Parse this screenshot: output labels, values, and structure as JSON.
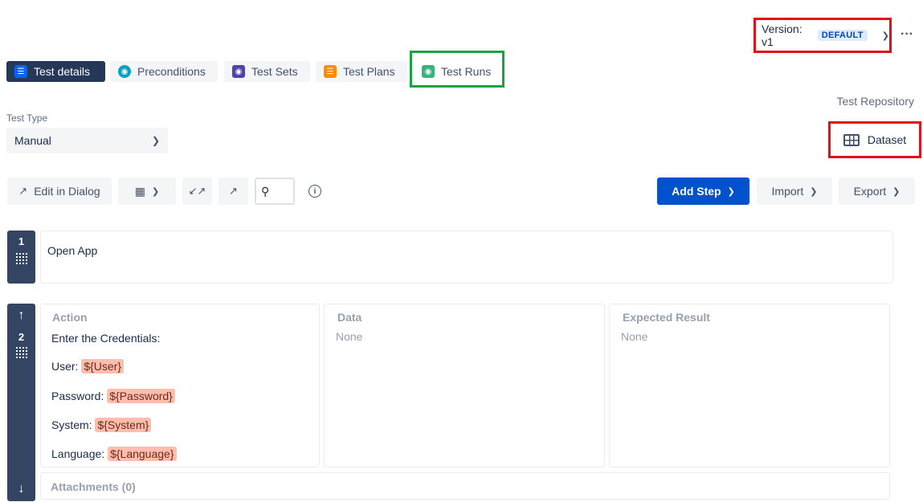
{
  "version": {
    "label": "Version: v1",
    "badge": "DEFAULT"
  },
  "more": "···",
  "tabs": [
    {
      "label": "Test details",
      "active": true,
      "icon": "list-icon",
      "color": "#0065ff"
    },
    {
      "label": "Preconditions",
      "active": false,
      "icon": "precondition-icon",
      "color": "#00a3bf"
    },
    {
      "label": "Test Sets",
      "active": false,
      "icon": "testset-icon",
      "color": "#5243aa"
    },
    {
      "label": "Test Plans",
      "active": false,
      "icon": "testplan-icon",
      "color": "#ff8b00"
    },
    {
      "label": "Test Runs",
      "active": false,
      "icon": "testrun-icon",
      "color": "#36b37e"
    }
  ],
  "test_type": {
    "label": "Test Type",
    "value": "Manual"
  },
  "repository_link": "Test Repository",
  "dataset_label": "Dataset",
  "toolbar": {
    "edit_dialog": "Edit in Dialog",
    "add_step": "Add Step",
    "import": "Import",
    "export": "Export"
  },
  "steps": [
    {
      "number": "1",
      "action": "Open App"
    },
    {
      "number": "2",
      "headers": {
        "action": "Action",
        "data": "Data",
        "expected": "Expected Result"
      },
      "action_title": "Enter the Credentials:",
      "fields": [
        {
          "label": "User:",
          "param": "${User}"
        },
        {
          "label": "Password:",
          "param": "${Password}"
        },
        {
          "label": "System:",
          "param": "${System}"
        },
        {
          "label": "Language:",
          "param": "${Language}"
        }
      ],
      "data": "None",
      "expected": "None",
      "attachments": "Attachments (0)"
    }
  ],
  "colors": {
    "primary": "#0052cc",
    "highlight_red": "#e0101a",
    "highlight_green": "#1aa33f",
    "param_bg": "#ffbdad"
  }
}
